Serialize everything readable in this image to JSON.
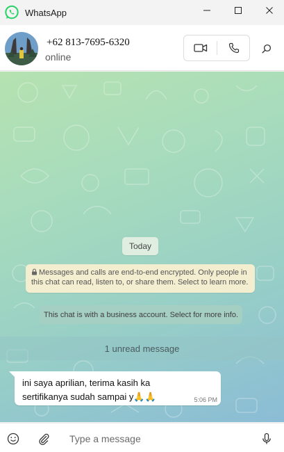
{
  "window": {
    "title": "WhatsApp"
  },
  "header": {
    "name": "+62 813-7695-6320",
    "status": "online"
  },
  "chat": {
    "date_label": "Today",
    "encryption_notice": "Messages and calls are end-to-end encrypted. Only people in this chat can read, listen to, or share them. Select to learn more.",
    "business_notice": "This chat is with a business account. Select for more info.",
    "unread_label": "1 unread message",
    "messages": [
      {
        "text": "ini saya aprilian, terima kasih ka sertifikanya sudah sampai y🙏🙏",
        "time": "5:06 PM",
        "direction": "incoming"
      }
    ]
  },
  "composer": {
    "placeholder": "Type a message"
  },
  "icons": {
    "app": "whatsapp-logo-icon",
    "minimize": "minimize-icon",
    "maximize": "maximize-icon",
    "close": "close-icon",
    "video": "video-camera-icon",
    "voice": "phone-icon",
    "search": "search-icon",
    "emoji": "emoji-icon",
    "attach": "paperclip-icon",
    "mic": "microphone-icon",
    "lock": "lock-icon"
  },
  "colors": {
    "brand": "#25d366",
    "bubble_in": "#ffffff",
    "encryption_bg": "#f4eed0"
  }
}
